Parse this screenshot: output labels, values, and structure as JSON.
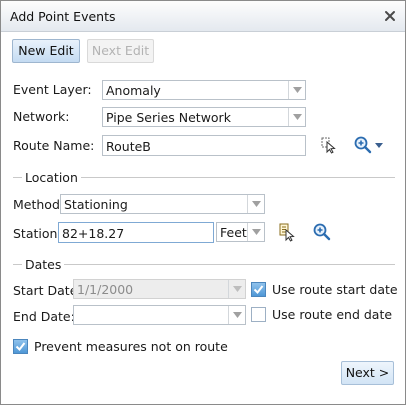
{
  "dialog": {
    "title": "Add Point Events"
  },
  "toolbar": {
    "new_edit_label": "New Edit",
    "next_edit_label": "Next Edit"
  },
  "form": {
    "event_layer": {
      "label": "Event Layer:",
      "value": "Anomaly"
    },
    "network": {
      "label": "Network:",
      "value": "Pipe Series Network"
    },
    "route_name": {
      "label": "Route Name:",
      "value": "RouteB"
    }
  },
  "location": {
    "section_title": "Location",
    "method": {
      "label": "Method:",
      "value": "Stationing"
    },
    "station": {
      "label": "Station:",
      "value": "82+18.27",
      "unit": "Feet"
    }
  },
  "dates": {
    "section_title": "Dates",
    "start_date": {
      "label": "Start Date:",
      "value": "1/1/2000",
      "checkbox_label": "Use route start date",
      "checkbox_checked": true
    },
    "end_date": {
      "label": "End Date:",
      "value": "",
      "checkbox_label": "Use route end date",
      "checkbox_checked": false
    }
  },
  "options": {
    "prevent_measures_label": "Prevent measures not on route",
    "prevent_measures_checked": true
  },
  "footer": {
    "next_label": "Next >"
  },
  "colors": {
    "accent_blue": "#4f97d6",
    "button_border": "#9eb6cf"
  }
}
